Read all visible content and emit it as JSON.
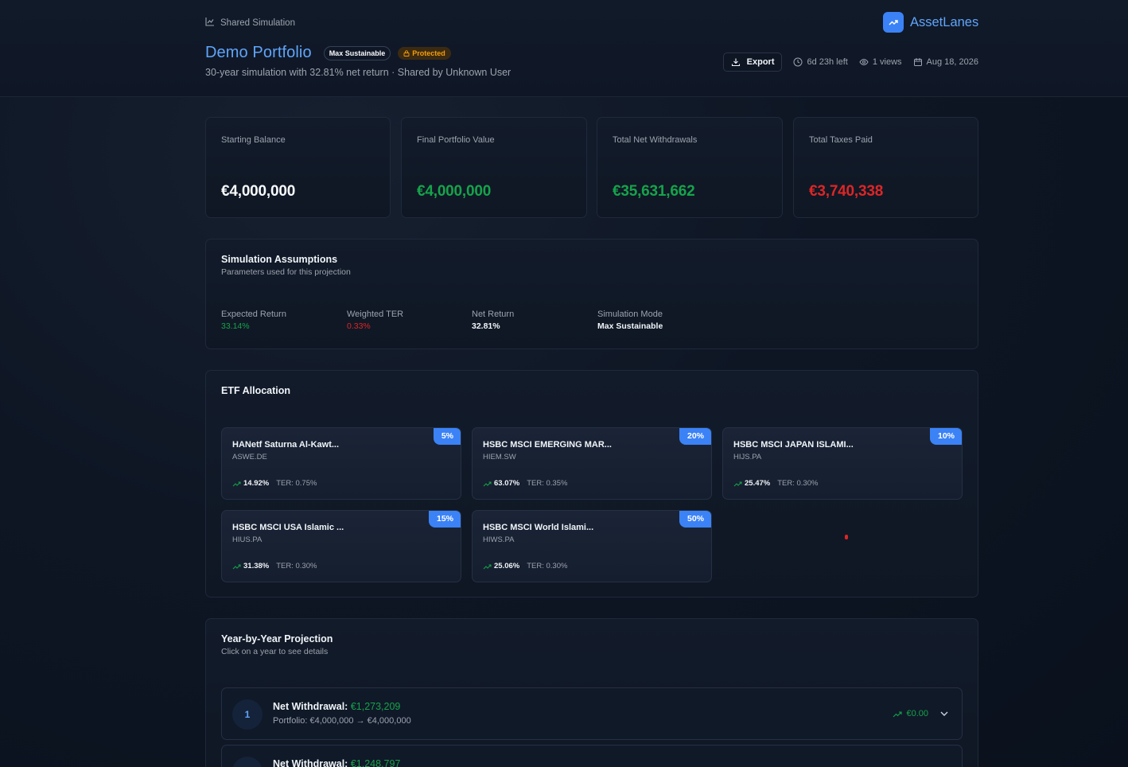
{
  "header": {
    "breadcrumb": "Shared Simulation",
    "title": "Demo Portfolio",
    "badge_mode": "Max Sustainable",
    "badge_protected": "Protected",
    "subtitle": "30-year simulation with 32.81% net return · Shared by Unknown User",
    "brand": "AssetLanes",
    "export_label": "Export",
    "time_left": "6d 23h left",
    "views": "1 views",
    "date": "Aug 18, 2026"
  },
  "stats": [
    {
      "label": "Starting Balance",
      "value": "€4,000,000"
    },
    {
      "label": "Final Portfolio Value",
      "value": "€4,000,000"
    },
    {
      "label": "Total Net Withdrawals",
      "value": "€35,631,662"
    },
    {
      "label": "Total Taxes Paid",
      "value": "€3,740,338"
    }
  ],
  "assumptions": {
    "title": "Simulation Assumptions",
    "subtitle": "Parameters used for this projection",
    "items": [
      {
        "label": "Expected Return",
        "value": "33.14%"
      },
      {
        "label": "Weighted TER",
        "value": "0.33%"
      },
      {
        "label": "Net Return",
        "value": "32.81%"
      },
      {
        "label": "Simulation Mode",
        "value": "Max Sustainable"
      }
    ]
  },
  "etf": {
    "title": "ETF Allocation",
    "items": [
      {
        "name": "HANetf Saturna Al-Kawt...",
        "ticker": "ASWE.DE",
        "return": "14.92%",
        "ter": "TER: 0.75%",
        "weight": "5%"
      },
      {
        "name": "HSBC MSCI EMERGING MAR...",
        "ticker": "HIEM.SW",
        "return": "63.07%",
        "ter": "TER: 0.35%",
        "weight": "20%"
      },
      {
        "name": "HSBC MSCI JAPAN ISLAMI...",
        "ticker": "HIJS.PA",
        "return": "25.47%",
        "ter": "TER: 0.30%",
        "weight": "10%"
      },
      {
        "name": "HSBC MSCI USA Islamic ...",
        "ticker": "HIUS.PA",
        "return": "31.38%",
        "ter": "TER: 0.30%",
        "weight": "15%"
      },
      {
        "name": "HSBC MSCI World Islami...",
        "ticker": "HIWS.PA",
        "return": "25.06%",
        "ter": "TER: 0.30%",
        "weight": "50%"
      }
    ]
  },
  "projection": {
    "title": "Year-by-Year Projection",
    "subtitle": "Click on a year to see details",
    "rows": [
      {
        "year": "1",
        "label": "Net Withdrawal:",
        "withdrawal": "€1,273,209",
        "portfolio": "Portfolio: €4,000,000 → €4,000,000",
        "change": "€0.00"
      },
      {
        "year": "2",
        "label": "Net Withdrawal:",
        "withdrawal": "€1,248,797",
        "portfolio": "",
        "change": ""
      }
    ]
  },
  "colors": {
    "accent": "#3b82f6",
    "positive": "#16a34a",
    "negative": "#dc2626",
    "warning": "#f59e0b"
  }
}
